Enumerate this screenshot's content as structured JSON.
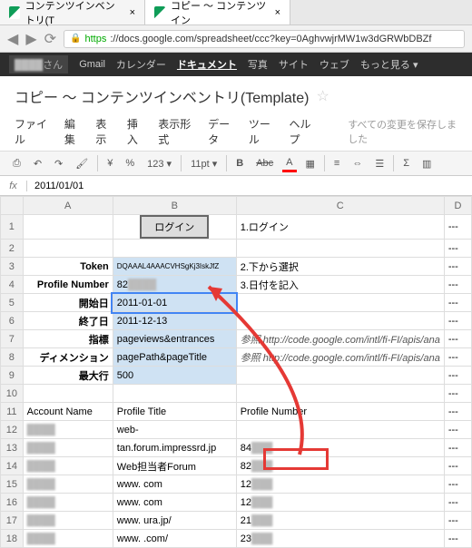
{
  "tabs": [
    {
      "title": "コンテンツインベントリ(T"
    },
    {
      "title": "コピー ～ コンテンツイン"
    }
  ],
  "url": {
    "https": "https",
    "host": "://docs.google.com",
    "path": "/spreadsheet/ccc?key=0AghvwjrMW1w3dGRWbDBZf"
  },
  "blackbar": {
    "user": "さん",
    "items": [
      "Gmail",
      "カレンダー",
      "ドキュメント",
      "写真",
      "サイト",
      "ウェブ",
      "もっと見る ▾"
    ],
    "activeIndex": 2
  },
  "doc": {
    "title": "コピー ～ コンテンツインベントリ(Template)",
    "star": "☆"
  },
  "menus": [
    "ファイル",
    "編集",
    "表示",
    "挿入",
    "表示形式",
    "データ",
    "ツール",
    "ヘルプ"
  ],
  "saveStatus": "すべての変更を保存しました",
  "toolbar": {
    "print": "⎙",
    "undo": "↶",
    "redo": "↷",
    "paint": "🖌",
    "currency": "¥",
    "pct": "%",
    "dec": "123 ▾",
    "fontsize": "11pt ▾",
    "bold": "B",
    "strike": "Abc",
    "textcolor": "A",
    "fill": "▦",
    "align": "≡",
    "merge": "⇔",
    "wrap": "☰",
    "formula": "Σ",
    "chart": "▥"
  },
  "fx": {
    "label": "fx",
    "value": "2011/01/01"
  },
  "cols": [
    "",
    "A",
    "B",
    "C",
    "D"
  ],
  "rows": {
    "1": {
      "b_btn": "ログイン",
      "c": "1.ログイン"
    },
    "2": {},
    "3": {
      "a": "Token",
      "b": "DQAAAL4AAACVHSgKj3IskJfZ",
      "c": "2.下から選択"
    },
    "4": {
      "a": "Profile Number",
      "b": "82",
      "c": "3.日付を記入"
    },
    "5": {
      "a": "開始日",
      "b": "2011-01-01"
    },
    "6": {
      "a": "終了日",
      "b": "2011-12-13"
    },
    "7": {
      "a": "指標",
      "b": "pageviews&entrances",
      "c": "参照 http://code.google.com/intl/fi-FI/apis/ana"
    },
    "8": {
      "a": "ディメンション",
      "b": "pagePath&pageTitle",
      "c": "参照 http://code.google.com/intl/fi-FI/apis/ana"
    },
    "9": {
      "a": "最大行",
      "b": "500"
    },
    "10": {},
    "11": {
      "a": "Account Name",
      "b": "Profile Title",
      "c": "Profile Number"
    },
    "12": {
      "b": "web-"
    },
    "13": {
      "b": "tan.forum.impressrd.jp",
      "c": "84"
    },
    "14": {
      "b": "Web担当者Forum",
      "c": "82"
    },
    "15": {
      "b": "www.            com",
      "c": "12"
    },
    "16": {
      "b": "www.            com",
      "c": "12"
    },
    "17": {
      "b": "www.            ura.jp/",
      "c": "21"
    },
    "18": {
      "b": "www.            .com/",
      "c": "23"
    }
  },
  "chart_data": {
    "type": "table",
    "title": "コンテンツインベントリ(Template)",
    "fields": [
      {
        "label": "Token",
        "value": "DQAAAL4AAACVHSgKj3IskJfZ"
      },
      {
        "label": "Profile Number",
        "value": "82"
      },
      {
        "label": "開始日",
        "value": "2011-01-01"
      },
      {
        "label": "終了日",
        "value": "2011-12-13"
      },
      {
        "label": "指標",
        "value": "pageviews&entrances"
      },
      {
        "label": "ディメンション",
        "value": "pagePath&pageTitle"
      },
      {
        "label": "最大行",
        "value": 500
      }
    ],
    "profiles_header": [
      "Account Name",
      "Profile Title",
      "Profile Number"
    ],
    "profiles": [
      {
        "title": "web-tan.forum.impressrd.jp",
        "number": 84
      },
      {
        "title": "Web担当者Forum",
        "number": 82
      },
      {
        "title": "www. … com",
        "number": 12
      },
      {
        "title": "www. … com",
        "number": 12
      },
      {
        "title": "www. … ura.jp/",
        "number": 21
      },
      {
        "title": "www. … .com/",
        "number": 23
      }
    ]
  }
}
